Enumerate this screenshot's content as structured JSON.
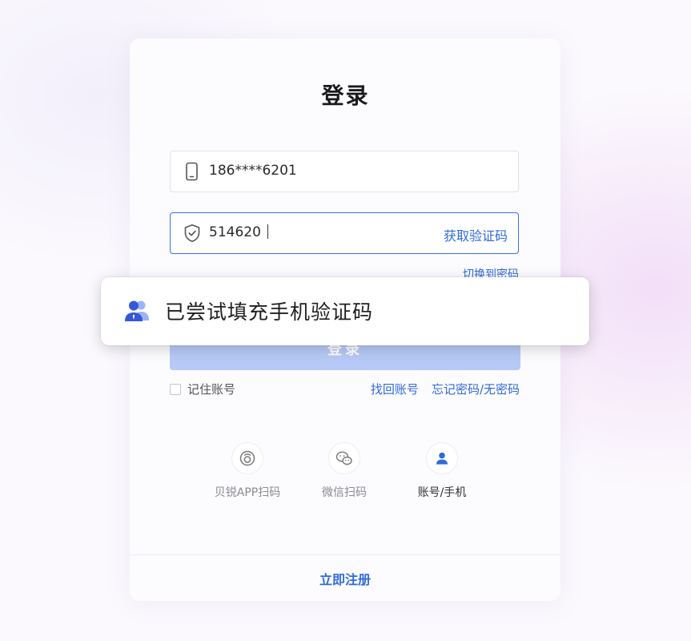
{
  "login": {
    "title": "登录",
    "phone": {
      "value": "186****6201",
      "icon": "phone-icon"
    },
    "code": {
      "value": "514620",
      "icon": "shield-check-icon",
      "get_code_label": "获取验证码"
    },
    "switch_to_password": "切换到密码",
    "login_button": "登录",
    "remember_label": "记住账号",
    "remember_checked": false,
    "recover_account": "找回账号",
    "forgot_password": "忘记密码/无密码",
    "methods": [
      {
        "label": "贝锐APP扫码",
        "icon": "app-scan-icon",
        "active": false
      },
      {
        "label": "微信扫码",
        "icon": "wechat-icon",
        "active": false
      },
      {
        "label": "账号/手机",
        "icon": "user-icon",
        "active": true
      }
    ],
    "register": "立即注册"
  },
  "toast": {
    "icon": "users-icon",
    "text": "已尝试填充手机验证码"
  },
  "colors": {
    "accent": "#2f6bd8",
    "button_disabled": "#b7c9f6",
    "field_focus_border": "#3a6fe0"
  }
}
